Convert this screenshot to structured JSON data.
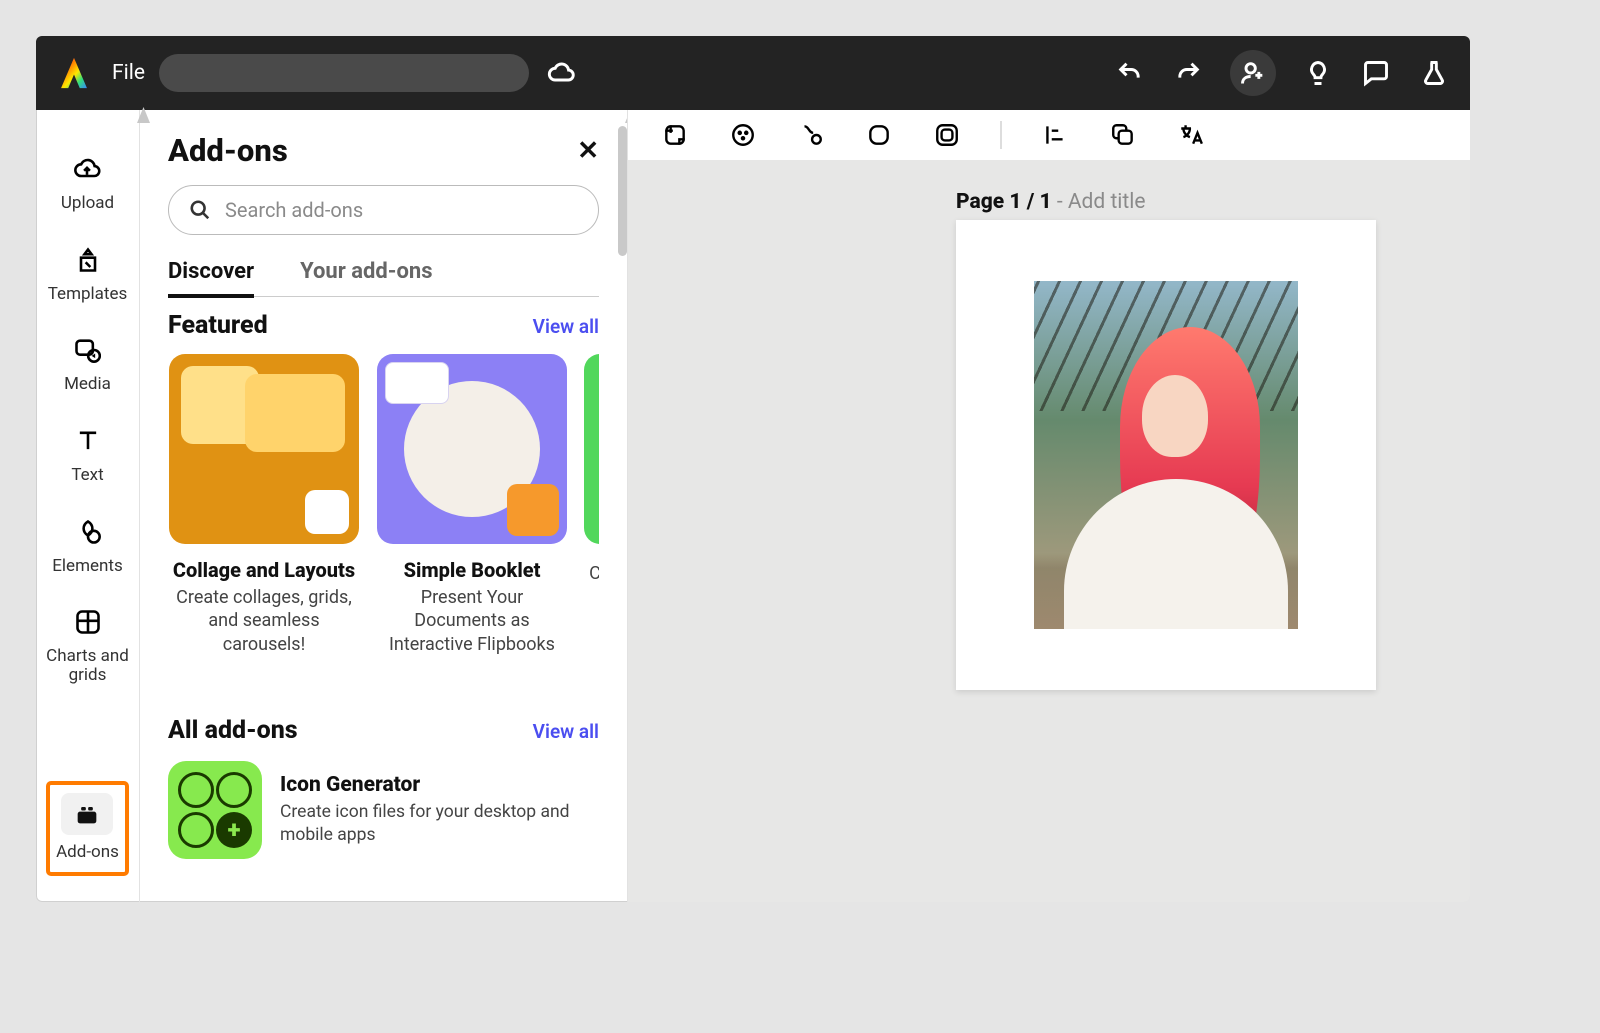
{
  "topbar": {
    "file_label": "File"
  },
  "rail": {
    "upload": "Upload",
    "templates": "Templates",
    "media": "Media",
    "text": "Text",
    "elements": "Elements",
    "charts": "Charts and grids",
    "addons": "Add-ons"
  },
  "panel": {
    "title": "Add-ons",
    "search_placeholder": "Search add-ons",
    "tabs": {
      "discover": "Discover",
      "your": "Your add-ons"
    },
    "featured": {
      "title": "Featured",
      "view_all": "View all",
      "cards": [
        {
          "title": "Collage and Layouts",
          "desc": "Create collages, grids, and seamless carousels!"
        },
        {
          "title": "Simple Booklet",
          "desc": "Present Your Documents as Interactive Flipbooks"
        },
        {
          "title": "",
          "desc": "C"
        }
      ]
    },
    "all": {
      "title": "All add-ons",
      "view_all": "View all",
      "items": [
        {
          "title": "Icon Generator",
          "desc": "Create icon files for your desktop and mobile apps"
        }
      ]
    }
  },
  "canvas": {
    "page_prefix": "Page 1 / 1",
    "page_sep": " - ",
    "page_placeholder": "Add title"
  }
}
